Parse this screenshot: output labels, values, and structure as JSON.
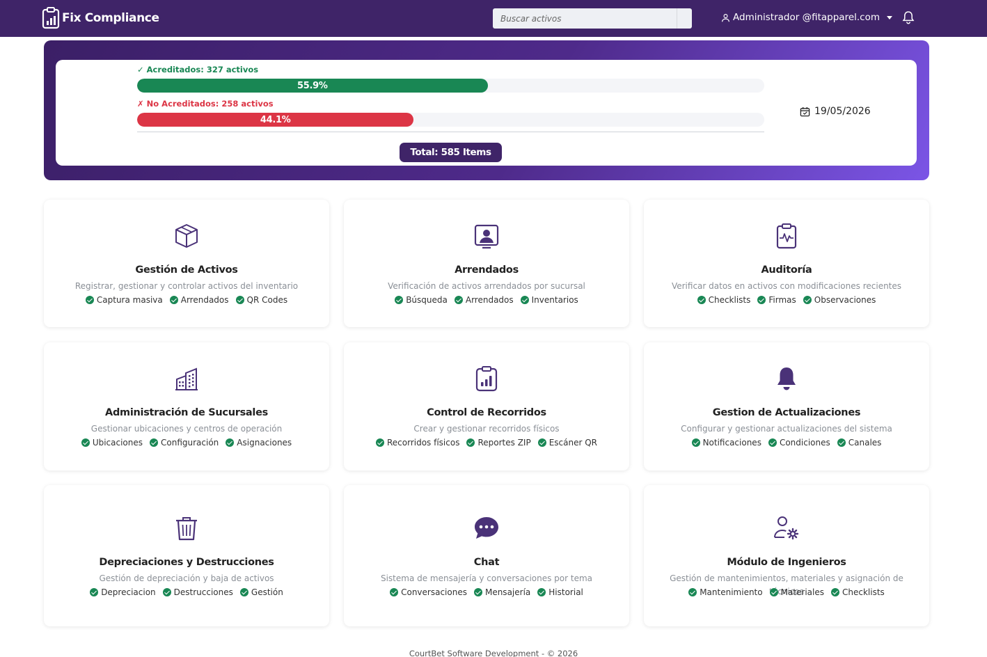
{
  "nav": {
    "brand": "Fix Compliance",
    "search_placeholder": "Buscar activos",
    "user": "Administrador @fitapparel.com"
  },
  "stats": {
    "accredited_label": "✓ Acreditados: 327 activos",
    "accredited_percent_label": "55.9%",
    "accredited_fraction": 0.559,
    "not_accredited_label": "✗ No Acreditados: 258 activos",
    "not_accredited_percent_label": "44.1%",
    "not_accredited_fraction": 0.441,
    "total_label": "Total: 585 Items",
    "date": "19/05/2026"
  },
  "colors": {
    "primary": "#3f2468",
    "success": "#198754",
    "danger": "#dc3545"
  },
  "modules": [
    {
      "icon": "box-icon",
      "title": "Gestión de Activos",
      "desc": "Registrar, gestionar y controlar activos del inventario",
      "tags": [
        "Captura masiva",
        "Arrendados",
        "QR Codes"
      ]
    },
    {
      "icon": "person-badge-icon",
      "title": "Arrendados",
      "desc": "Verificación de activos arrendados por sucursal",
      "tags": [
        "Búsqueda",
        "Arrendados",
        "Inventarios"
      ]
    },
    {
      "icon": "clipboard-pulse-icon",
      "title": "Auditoría",
      "desc": "Verificar datos en activos con modificaciones recientes",
      "tags": [
        "Checklists",
        "Firmas",
        "Observaciones"
      ]
    },
    {
      "icon": "buildings-icon",
      "title": "Administración de Sucursales",
      "desc": "Gestionar ubicaciones y centros de operación",
      "tags": [
        "Ubicaciones",
        "Configuración",
        "Asignaciones"
      ]
    },
    {
      "icon": "clipboard-data-icon",
      "title": "Control de Recorridos",
      "desc": "Crear y gestionar recorridos físicos",
      "tags": [
        "Recorridos físicos",
        "Reportes ZIP",
        "Escáner QR"
      ]
    },
    {
      "icon": "bell-fill-icon",
      "title": "Gestion de Actualizaciones",
      "desc": "Configurar y gestionar actualizaciones del sistema",
      "tags": [
        "Notificaciones",
        "Condiciones",
        "Canales"
      ]
    },
    {
      "icon": "trash-icon",
      "title": "Depreciaciones y Destrucciones",
      "desc": "Gestión de depreciación y baja de activos",
      "tags": [
        "Depreciacion",
        "Destrucciones",
        "Gestión"
      ]
    },
    {
      "icon": "chat-dots-icon",
      "title": "Chat",
      "desc": "Sistema de mensajería y conversaciones por tema",
      "tags": [
        "Conversaciones",
        "Mensajería",
        "Historial"
      ]
    },
    {
      "icon": "person-gear-icon",
      "title": "Módulo de Ingenieros",
      "desc": "Gestión de mantenimientos, materiales y asignación de técnicos",
      "tags": [
        "Mantenimiento",
        "Materiales",
        "Checklists"
      ]
    }
  ],
  "footer": "CourtBet Software Development - © 2026"
}
